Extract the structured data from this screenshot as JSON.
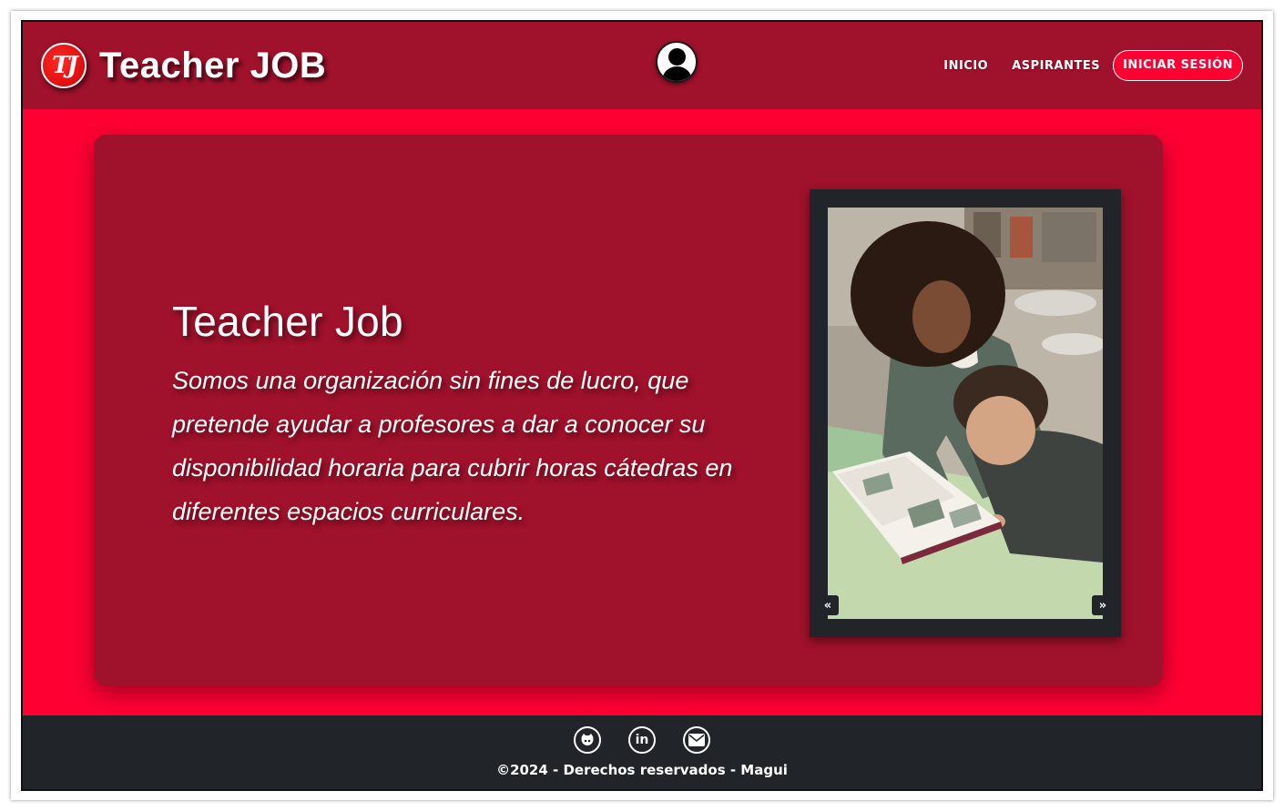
{
  "header": {
    "logo_initials": "TJ",
    "brand": "Teacher JOB",
    "nav": {
      "inicio": "INICIO",
      "aspirantes": "ASPIRANTES",
      "login": "INICIAR SESIÓN"
    },
    "avatar_icon": "user-icon"
  },
  "hero": {
    "title": "Teacher Job",
    "description": "Somos una organización sin fines de lucro, que pretende ayudar a profesores a dar a conocer su disponibilidad horaria para cubrir horas cátedras en diferentes espacios curriculares.",
    "carousel": {
      "prev": "«",
      "next": "»"
    }
  },
  "footer": {
    "icons": [
      "github-icon",
      "linkedin-icon",
      "email-icon"
    ],
    "linkedin_glyph": "in",
    "copyright": "©2024 - Derechos reservados - Magui"
  },
  "colors": {
    "navbar": "#a0112b",
    "accent": "#ff0033",
    "card": "#a0112b",
    "footer": "#212529"
  }
}
